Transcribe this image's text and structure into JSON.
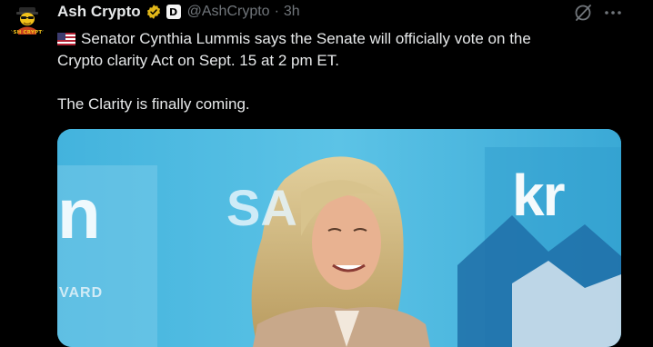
{
  "author": {
    "avatar_caption": "ASH CRYPTO",
    "display_name": "Ash Crypto",
    "affiliate_badge": "D",
    "handle": "@AshCrypto",
    "separator": "·",
    "time": "3h"
  },
  "tweet": {
    "line1": "Senator Cynthia Lummis says the Senate will officially vote on the",
    "line2": "Crypto clarity Act on Sept. 15 at 2 pm ET.",
    "line3": "The Clarity is finally coming."
  },
  "media": {
    "backdrop_left_text": "n",
    "backdrop_left_caption": "VARD",
    "backdrop_center_text": "SA",
    "backdrop_logo_text": "kr"
  },
  "icons": {
    "verified": "verified-badge-icon",
    "flag": "us-flag-icon",
    "grok": "grok-icon",
    "more": "more-options-icon",
    "avatar": "avatar-cartoon"
  },
  "colors": {
    "background": "#000000",
    "primary_text": "#e7e9ea",
    "secondary_text": "#71767b",
    "verified_gold": "#e2b719",
    "media_backdrop": "#4bb8e0"
  }
}
